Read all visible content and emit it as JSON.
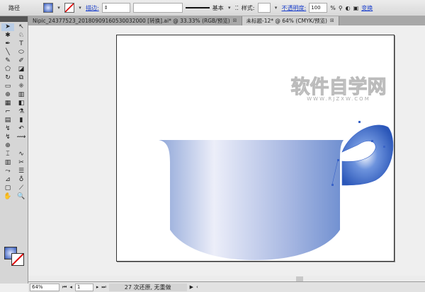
{
  "control_bar": {
    "object_type": "路径",
    "stroke_label": "描边:",
    "style_label": "样式:",
    "stroke_profile": "基本",
    "opacity_label": "不透明度:",
    "opacity_value": "100",
    "opacity_unit": "%",
    "transform_label": "变换"
  },
  "tabs": [
    {
      "label": "Nipic_24377523_20180909160530032000 [转换].ai* @ 33.33% (RGB/预览)",
      "active": false
    },
    {
      "label": "未标题-12* @ 64% (CMYK/预览)",
      "active": true
    }
  ],
  "tools": [
    "➤",
    "↖",
    "✱",
    "♘",
    "✒",
    "T",
    "╲",
    "⬭",
    "✎",
    "✐",
    "⬠",
    "◪",
    "↻",
    "⧉",
    "▭",
    "⁜",
    "⊕",
    "▥",
    "▦",
    "◧",
    "⌐",
    "⚗",
    "▤",
    "▮",
    "↯",
    "↶",
    "↯",
    "⟿",
    "⊕",
    "",
    "⌶",
    "∿",
    "▥",
    "✂",
    "⤳",
    "☰",
    "⊿",
    "♁",
    "▢",
    "⟋",
    "✋",
    "🔍"
  ],
  "watermark": {
    "title": "软件自学网",
    "url": "WWW.RJZXW.COM"
  },
  "status": {
    "zoom": "64%",
    "page": "1",
    "message": "27 次还原, 无重做"
  },
  "colors": {
    "pot_light": "#eceef9",
    "pot_dark": "#6f8fd0",
    "handle": "#2f5fc0"
  }
}
